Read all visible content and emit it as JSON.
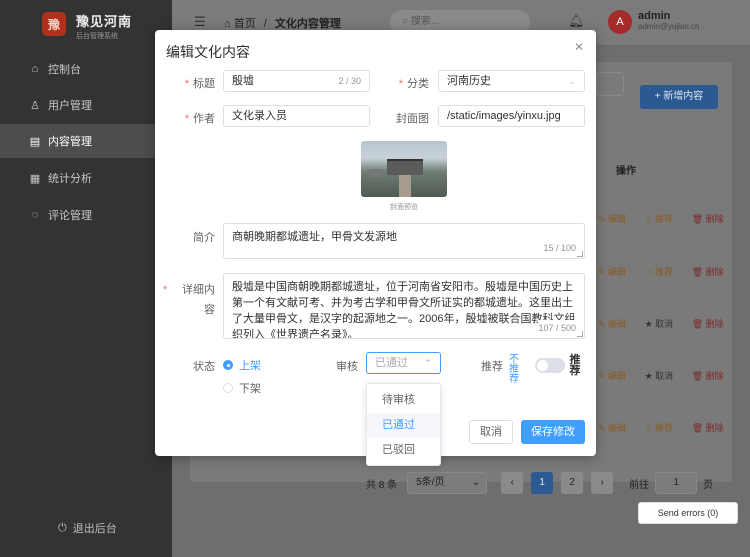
{
  "app": {
    "logo_char": "豫",
    "logo_title": "豫见河南",
    "logo_subtitle": "后台管理系统"
  },
  "sidebar": {
    "items": [
      {
        "label": "控制台",
        "icon": "home-icon",
        "glyph": "⌂"
      },
      {
        "label": "用户管理",
        "icon": "user-icon",
        "glyph": "♙"
      },
      {
        "label": "内容管理",
        "icon": "document-icon",
        "glyph": "▤"
      },
      {
        "label": "统计分析",
        "icon": "chart-icon",
        "glyph": "▦"
      },
      {
        "label": "评论管理",
        "icon": "comment-icon",
        "glyph": "◌"
      }
    ],
    "logout_label": "退出后台"
  },
  "topbar": {
    "crumb_home": "首页",
    "crumb_sep": "/",
    "crumb_current": "文化内容管理",
    "search_placeholder": "搜索...",
    "avatar_letter": "A",
    "user_name": "admin",
    "user_email": "admin@yujian.cn"
  },
  "background": {
    "add_button": "+ 新增内容",
    "ops_header": "操作",
    "rows": [
      {
        "edit": "编辑",
        "rec": "推荐",
        "del": "删除"
      },
      {
        "edit": "编辑",
        "rec": "推荐",
        "del": "删除"
      },
      {
        "edit": "编辑",
        "rec": "取消",
        "del": "删除"
      },
      {
        "edit": "编辑",
        "rec": "取消",
        "del": "删除"
      },
      {
        "edit": "编辑",
        "rec": "推荐",
        "del": "删除"
      }
    ],
    "pager": {
      "total": "共 8 条",
      "page_size": "5条/页",
      "pages": [
        "1",
        "2"
      ],
      "goto_label": "前往",
      "goto_value": "1",
      "page_unit": "页"
    }
  },
  "dialog": {
    "title": "编辑文化内容",
    "fields": {
      "title_label": "标题",
      "title_value": "殷墟",
      "title_count": "2 / 30",
      "category_label": "分类",
      "category_value": "河南历史",
      "author_label": "作者",
      "author_value": "文化录入员",
      "cover_label": "封面图",
      "cover_value": "/static/images/yinxu.jpg",
      "cover_caption": "封面预览",
      "summary_label": "简介",
      "summary_value": "商朝晚期都城遗址，甲骨文发源地",
      "summary_count": "15 / 100",
      "detail_label_1": "详细内",
      "detail_label_2": "容",
      "detail_value": "殷墟是中国商朝晚期都城遗址，位于河南省安阳市。殷墟是中国历史上第一个有文献可考、并为考古学和甲骨文所证实的都城遗址。这里出土了大量甲骨文，是汉字的起源地之一。2006年，殷墟被联合国教科文组织列入《世界遗产名录》。",
      "detail_count": "107 / 500",
      "status_label": "状态",
      "status_on": "上架",
      "status_off": "下架",
      "review_label": "审核",
      "review_placeholder": "已通过",
      "recommend_label": "推荐",
      "recommend_off": "不推荐",
      "recommend_on": "推荐"
    },
    "review_options": [
      "待审核",
      "已通过",
      "已驳回"
    ],
    "review_selected_index": 1,
    "cancel_label": "取消",
    "save_label": "保存修改"
  },
  "send_errors": "Send errors (0)",
  "colors": {
    "primary": "#409eff",
    "danger": "#f56c6c",
    "sidebar_bg": "#333333"
  }
}
